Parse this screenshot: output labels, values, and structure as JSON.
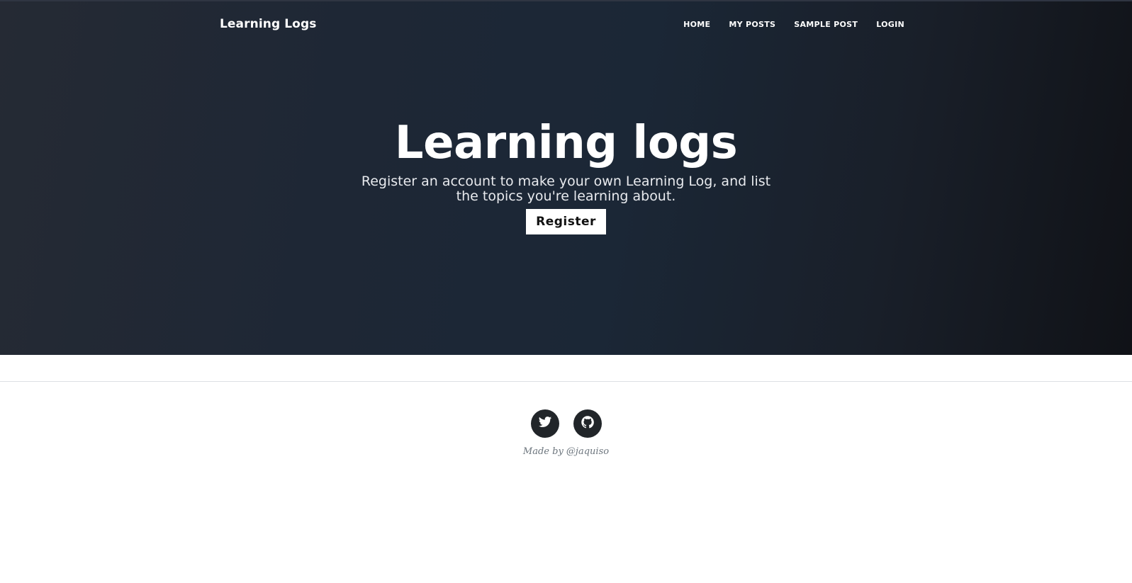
{
  "brand": {
    "title": "Learning Logs"
  },
  "nav": {
    "items": [
      {
        "label": "HOME"
      },
      {
        "label": "MY POSTS"
      },
      {
        "label": "SAMPLE POST"
      },
      {
        "label": "LOGIN"
      }
    ]
  },
  "hero": {
    "title": "Learning logs",
    "subtitle": "Register an account to make your own Learning Log, and list the topics you're learning about.",
    "register_label": "Register"
  },
  "footer": {
    "social": [
      {
        "icon": "twitter-icon"
      },
      {
        "icon": "github-icon"
      }
    ],
    "credit": "Made by @jaquiso"
  },
  "colors": {
    "hero_dark": "#1b2736",
    "social_button": "#212529",
    "credit_text": "#6c757d"
  }
}
